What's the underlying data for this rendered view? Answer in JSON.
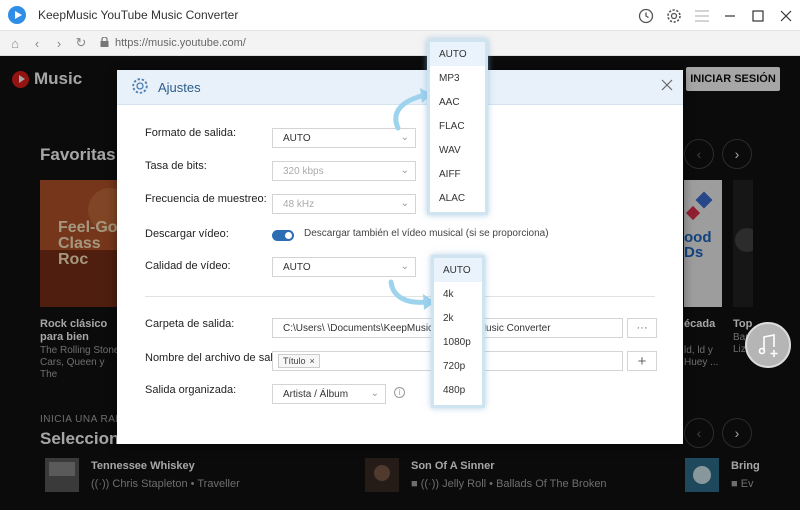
{
  "app": {
    "title": "KeepMusic YouTube Music Converter"
  },
  "browser": {
    "url": "https://music.youtube.com/"
  },
  "ytm": {
    "logo_text": "Music",
    "signin": "INICIAR SESIÓN",
    "section1_title": "Favoritas p",
    "section2_caption": "INICIA UNA RADIO",
    "section2_title": "Seleccione",
    "cards": [
      {
        "art_text": "Feel-Go Class Roc",
        "title": "Rock clásico para bien",
        "sub": "The Rolling Stone Cars, Queen y The"
      },
      {
        "art_text": "ood Ds",
        "title": "écada",
        "sub": "ld, ld y Huey ..."
      },
      {
        "art_text": "",
        "title": "Top",
        "sub": "Banc Lizá"
      }
    ],
    "tracks": [
      {
        "title": "Tennessee Whiskey",
        "sub": "Chris Stapleton • Traveller"
      },
      {
        "title": "Son Of A Sinner",
        "sub": "Jelly Roll • Ballads Of The Broken"
      },
      {
        "title": "Bring",
        "sub": "Ev"
      }
    ]
  },
  "dialog": {
    "title": "Ajustes",
    "rows": {
      "format_label": "Formato de salida:",
      "format_value": "AUTO",
      "bitrate_label": "Tasa de bits:",
      "bitrate_value": "320 kbps",
      "sample_label": "Frecuencia de muestreo:",
      "sample_value": "48 kHz",
      "video_label": "Descargar vídeo:",
      "video_toggle_text": "Descargar también el vídeo musical (si se proporciona)",
      "quality_label": "Calidad de vídeo:",
      "quality_value": "AUTO",
      "folder_label": "Carpeta de salida:",
      "folder_value": "C:\\Users\\        \\Documents\\KeepMusic YouTube Music Converter",
      "folder_btn": "···",
      "filename_label": "Nombre del archivo de sali...",
      "filename_tag": "Título",
      "filename_add": "+",
      "organized_label": "Salida organizada:",
      "organized_value": "Artista / Álbum"
    }
  },
  "format_options": [
    "AUTO",
    "MP3",
    "AAC",
    "FLAC",
    "WAV",
    "AIFF",
    "ALAC"
  ],
  "quality_options": [
    "AUTO",
    "4k",
    "2k",
    "1080p",
    "720p",
    "480p"
  ]
}
